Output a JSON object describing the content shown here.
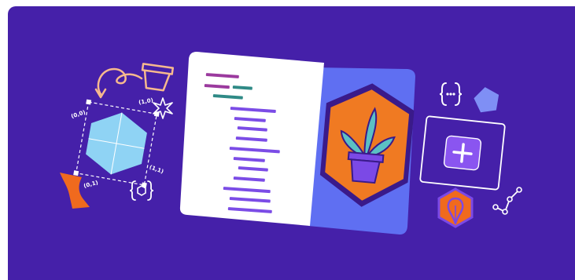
{
  "illustration": {
    "background_color": "#4520a9",
    "coordinate_labels": {
      "top_left": "(0,0)",
      "top_right": "(1,0)",
      "bottom_right": "(1,1)",
      "bottom_left": "(0,1)"
    },
    "colors": {
      "page_white": "#ffffff",
      "page_blue": "#5f6ff2",
      "hex_orange": "#f07a22",
      "hex_border": "#3a1a8a",
      "pot": "#7b49e6",
      "leaf": "#5bc0c4",
      "code_magenta": "#9b3a9e",
      "code_teal": "#2f8a86",
      "code_purple": "#7b4ce6",
      "accent_blue": "#8fd3f4",
      "accent_peach": "#f7b98e",
      "accent_periwinkle": "#7f8ff5",
      "accent_orange": "#f06a1e",
      "button_purple": "#8a55f0"
    },
    "icons": [
      "curly-arrow-icon",
      "flower-pot-icon",
      "sparkle-icon",
      "hexagon-wireframe-icon",
      "braces-hexagon-icon",
      "ribbon-shape-icon",
      "json-braces-icon",
      "pentagon-icon",
      "plus-button-icon",
      "map-pin-hexagon-icon",
      "node-graph-icon"
    ]
  }
}
